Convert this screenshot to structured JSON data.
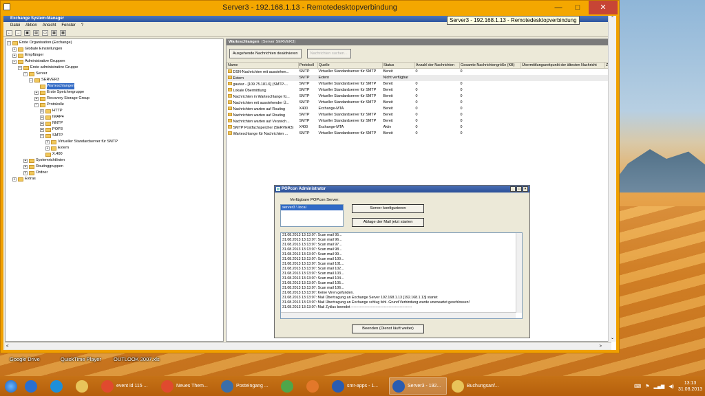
{
  "rdp": {
    "title": "Server3 - 192.168.1.13 - Remotedesktopverbindung",
    "tooltip": "Server3 - 192.168.1.13 - Remotedesktopverbindung",
    "min": "—",
    "max": "□",
    "close": "✕"
  },
  "esm": {
    "title": "Exchange System-Manager",
    "menu": [
      "Datei",
      "Aktion",
      "Ansicht",
      "Fenster",
      "?"
    ]
  },
  "tree": [
    {
      "label": "Erste Organisation (Exchange)",
      "indent": 0,
      "pm": "−"
    },
    {
      "label": "Globale Einstellungen",
      "indent": 1,
      "pm": "+"
    },
    {
      "label": "Empfänger",
      "indent": 1,
      "pm": "+"
    },
    {
      "label": "Administrative Gruppen",
      "indent": 1,
      "pm": "−"
    },
    {
      "label": "Erste administrative Gruppe",
      "indent": 2,
      "pm": "−"
    },
    {
      "label": "Server",
      "indent": 3,
      "pm": "−"
    },
    {
      "label": "SERVER3",
      "indent": 4,
      "pm": "−"
    },
    {
      "label": "Warteschlangen",
      "indent": 5,
      "pm": "",
      "sel": true
    },
    {
      "label": "Erste Speichergruppe",
      "indent": 5,
      "pm": "+"
    },
    {
      "label": "Recovery Storage Group",
      "indent": 5,
      "pm": "+"
    },
    {
      "label": "Protokolle",
      "indent": 5,
      "pm": "−"
    },
    {
      "label": "HTTP",
      "indent": 6,
      "pm": "+"
    },
    {
      "label": "IMAP4",
      "indent": 6,
      "pm": "+"
    },
    {
      "label": "NNTP",
      "indent": 6,
      "pm": "+"
    },
    {
      "label": "POP3",
      "indent": 6,
      "pm": "+"
    },
    {
      "label": "SMTP",
      "indent": 6,
      "pm": "−"
    },
    {
      "label": "Virtueller Standardserver für SMTP",
      "indent": 7,
      "pm": "+"
    },
    {
      "label": "Extern",
      "indent": 7,
      "pm": "+"
    },
    {
      "label": "X.400",
      "indent": 6,
      "pm": ""
    },
    {
      "label": "Systemrichtlinien",
      "indent": 3,
      "pm": "+"
    },
    {
      "label": "Routinggruppen",
      "indent": 3,
      "pm": "+"
    },
    {
      "label": "Ordner",
      "indent": 3,
      "pm": "+"
    },
    {
      "label": "Extras",
      "indent": 1,
      "pm": "+"
    }
  ],
  "panel": {
    "header": "Warteschlangen",
    "header_sub": "(Server SERVER3)",
    "btn1": "Ausgehende Nachrichten deaktivieren",
    "btn2": "Nachrichten suchen..."
  },
  "columns": [
    "Name",
    "Protokoll",
    "Quelle",
    "Status",
    "Anzahl der Nachrichten",
    "Gesamte Nachrichtengröße (KB)",
    "Übermittlungszeitpunkt der ältesten Nachricht",
    "Zeit"
  ],
  "rows": [
    [
      "DSN-Nachrichten mit ausstehen...",
      "SMTP",
      "Virtueller Standardserver für SMTP",
      "Bereit",
      "0",
      "0"
    ],
    [
      "Extern",
      "SMTP",
      "Extern",
      "Nicht verfügbar",
      "",
      ""
    ],
    [
      "gautaz - [109.75.181.6] (SMTP-...",
      "SMTP",
      "Virtueller Standardserver für SMTP",
      "Bereit",
      "0",
      "0"
    ],
    [
      "Lokale Übermittlung",
      "SMTP",
      "Virtueller Standardserver für SMTP",
      "Bereit",
      "0",
      "0"
    ],
    [
      "Nachrichten in Warteschlange fü...",
      "SMTP",
      "Virtueller Standardserver für SMTP",
      "Bereit",
      "0",
      "0"
    ],
    [
      "Nachrichten mit ausstehender Ü...",
      "SMTP",
      "Virtueller Standardserver für SMTP",
      "Bereit",
      "0",
      "0"
    ],
    [
      "Nachrichten warten auf Routing",
      "X400",
      "Exchange-MTA",
      "Bereit",
      "0",
      "0"
    ],
    [
      "Nachrichten warten auf Routing",
      "SMTP",
      "Virtueller Standardserver für SMTP",
      "Bereit",
      "0",
      "0"
    ],
    [
      "Nachrichten warten auf Verzeich...",
      "SMTP",
      "Virtueller Standardserver für SMTP",
      "Bereit",
      "0",
      "0"
    ],
    [
      "SMTP Postfachspeicher (SERVER3)",
      "X400",
      "Exchange-MTA",
      "Aktiv",
      "0",
      "0"
    ],
    [
      "Warteschlange für Nachrichten ...",
      "SMTP",
      "Virtueller Standardserver für SMTP",
      "Bereit",
      "0",
      "0"
    ]
  ],
  "dialog": {
    "title": "POPcon Administrator",
    "label": "Verfügbare POPcon Server:",
    "server": "server3 \\ local",
    "btn_config": "Server konfigurieren",
    "btn_start": "Ablage der Mail jetzt starten",
    "btn_end": "Beenden (Dienst läuft weiter)",
    "log": [
      "31.08.2013 13:13:07: Scan mail 95...",
      "31.08.2013 13:13:07: Scan mail 96...",
      "31.08.2013 13:13:07: Scan mail 97...",
      "31.08.2013 13:13:07: Scan mail 98...",
      "31.08.2013 13:13:07: Scan mail 99...",
      "31.08.2013 13:13:07: Scan mail 100...",
      "31.08.2013 13:13:07: Scan mail 101...",
      "31.08.2013 13:13:07: Scan mail 102...",
      "31.08.2013 13:13:07: Scan mail 103...",
      "31.08.2013 13:13:07: Scan mail 104...",
      "31.08.2013 13:13:07: Scan mail 105...",
      "31.08.2013 13:13:07: Scan mail 106...",
      "31.08.2013 13:13:07: Keine Viren gefunden.",
      "31.08.2013 13:13:07: Mail Übertragung an Exchange Server 192.168.1.13 [192.168.1.13] startet",
      "31.08.2013 13:13:07: Mail Übertragung an Exchange schlug fehl. Grund:Verbindung wurde unerwartet geschlossen!",
      "31.08.2013 13:13:07: Mail Zyklus beendet --------------------------------------------------"
    ]
  },
  "desktop": [
    "Google Drive",
    "QuickTime Player",
    "OUTLOOK 2007.xls"
  ],
  "taskbar": [
    {
      "label": "",
      "color": "#2a6fcf",
      "active": false
    },
    {
      "label": "",
      "color": "#1e8fd8",
      "active": false
    },
    {
      "label": "",
      "color": "#e8c45a",
      "active": false
    },
    {
      "label": "event id 115 ...",
      "color": "#e04a2e",
      "active": false
    },
    {
      "label": "Neues Them...",
      "color": "#e04a2e",
      "active": false
    },
    {
      "label": "Posteingang ...",
      "color": "#3b6ea8",
      "active": false
    },
    {
      "label": "",
      "color": "#4fa64a",
      "active": false
    },
    {
      "label": "",
      "color": "#e3782a",
      "active": false
    },
    {
      "label": "smr-apps - 1...",
      "color": "#2a5cb0",
      "active": false
    },
    {
      "label": "Server3 - 192...",
      "color": "#2a5cb0",
      "active": true
    },
    {
      "label": "Buchungsanf...",
      "color": "#e8c45a",
      "active": false
    }
  ],
  "tray": {
    "time": "13:13",
    "date": "31.08.2013",
    "lang": "⌨"
  }
}
